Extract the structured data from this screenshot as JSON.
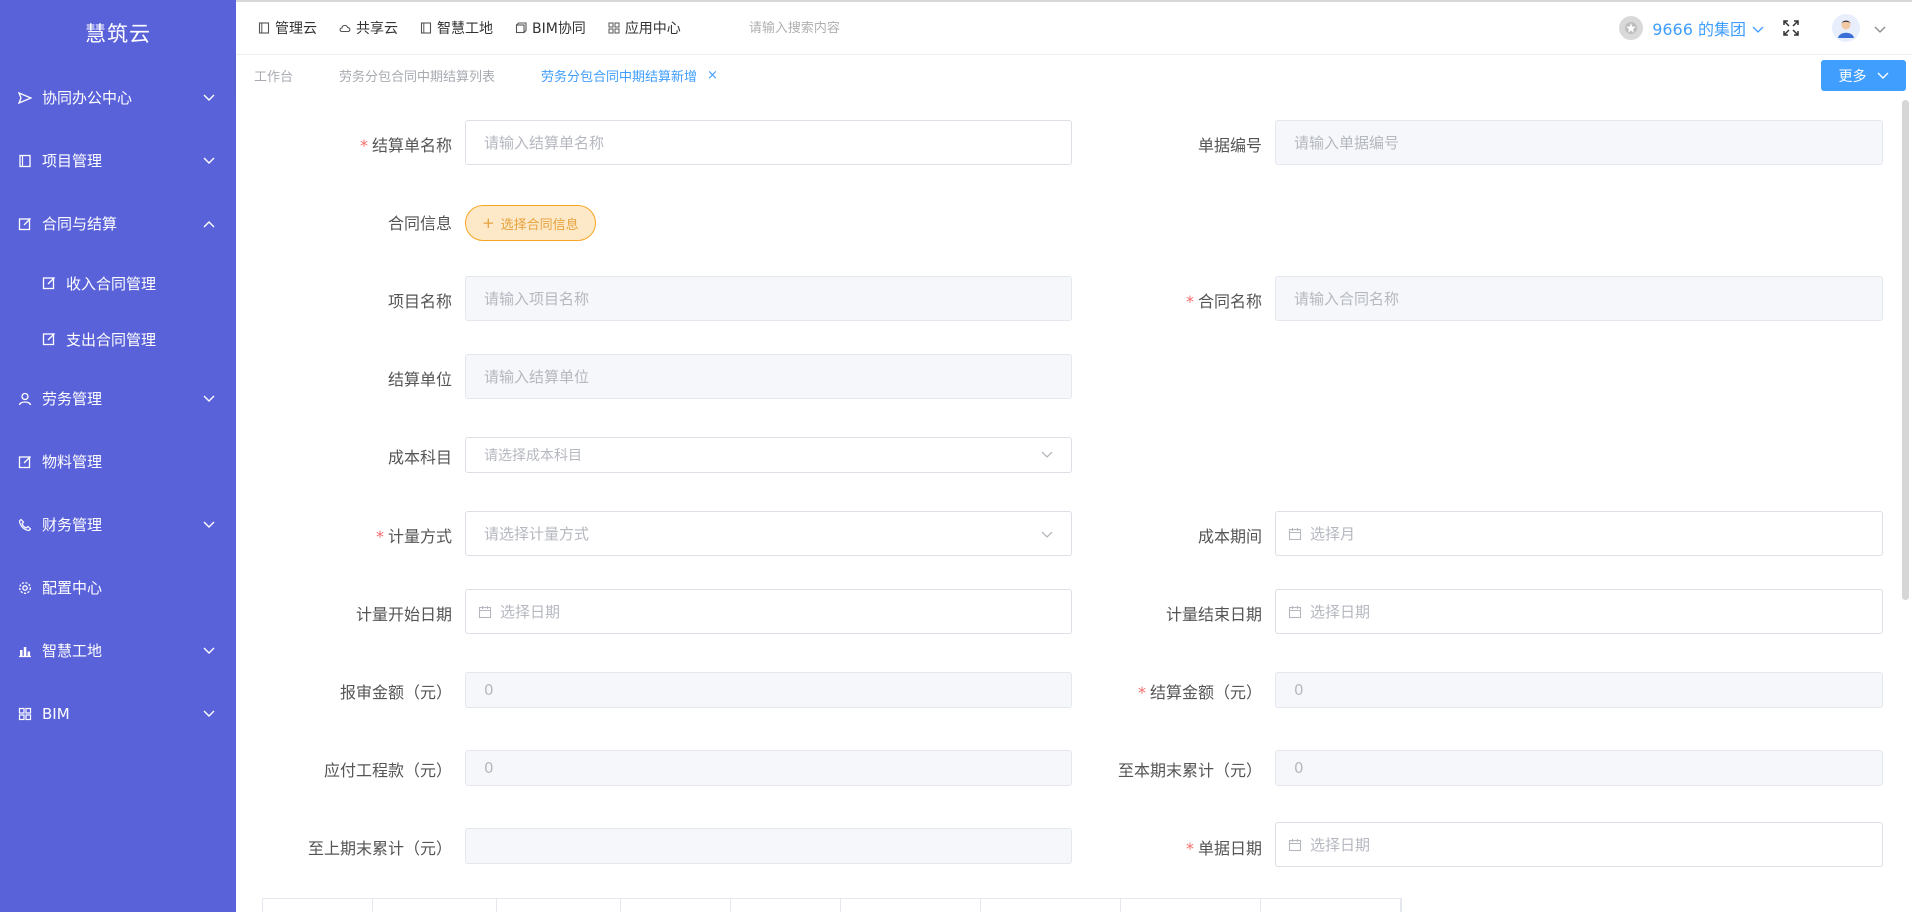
{
  "sidebar": {
    "logo": "慧筑云",
    "items": [
      {
        "label": "协同办公中心",
        "icon": "send-icon",
        "expandable": true
      },
      {
        "label": "项目管理",
        "icon": "book-icon",
        "expandable": true
      },
      {
        "label": "合同与结算",
        "icon": "edit-icon",
        "expandable": true,
        "expanded": true
      },
      {
        "label": "收入合同管理",
        "icon": "edit-icon",
        "sub": true
      },
      {
        "label": "支出合同管理",
        "icon": "edit-icon",
        "sub": true
      },
      {
        "label": "劳务管理",
        "icon": "user-icon",
        "expandable": true
      },
      {
        "label": "物料管理",
        "icon": "edit-icon",
        "expandable": false
      },
      {
        "label": "财务管理",
        "icon": "phone-icon",
        "expandable": true
      },
      {
        "label": "配置中心",
        "icon": "gear-icon",
        "expandable": false
      },
      {
        "label": "智慧工地",
        "icon": "bar-chart-icon",
        "expandable": true
      },
      {
        "label": "BIM",
        "icon": "grid-icon",
        "expandable": true
      }
    ]
  },
  "topbar": {
    "nav": [
      {
        "label": "管理云",
        "icon": "book-icon"
      },
      {
        "label": "共享云",
        "icon": "cloud-icon"
      },
      {
        "label": "智慧工地",
        "icon": "book-icon"
      },
      {
        "label": "BIM协同",
        "icon": "cube-icon"
      },
      {
        "label": "应用中心",
        "icon": "grid-icon"
      }
    ],
    "search_placeholder": "请输入搜索内容",
    "org_name": "9666 的集团"
  },
  "tabs": {
    "items": [
      {
        "label": "工作台",
        "active": false
      },
      {
        "label": "劳务分包合同中期结算列表",
        "active": false
      },
      {
        "label": "劳务分包合同中期结算新增",
        "active": true
      }
    ],
    "close_symbol": "×",
    "more_label": "更多"
  },
  "form": {
    "settlement_name": {
      "label": "结算单名称",
      "required": true,
      "placeholder": "请输入结算单名称"
    },
    "doc_number": {
      "label": "单据编号",
      "required": false,
      "placeholder": "请输入单据编号"
    },
    "contract_info": {
      "label": "合同信息",
      "button": "选择合同信息",
      "button_plus": "+"
    },
    "project_name": {
      "label": "项目名称",
      "required": false,
      "placeholder": "请输入项目名称"
    },
    "contract_name": {
      "label": "合同名称",
      "required": true,
      "placeholder": "请输入合同名称"
    },
    "settlement_unit": {
      "label": "结算单位",
      "required": false,
      "placeholder": "请输入结算单位"
    },
    "cost_subject": {
      "label": "成本科目",
      "required": false,
      "placeholder": "请选择成本科目"
    },
    "measure_method": {
      "label": "计量方式",
      "required": true,
      "placeholder": "请选择计量方式"
    },
    "cost_period": {
      "label": "成本期间",
      "required": false,
      "placeholder": "选择月"
    },
    "measure_start": {
      "label": "计量开始日期",
      "required": false,
      "placeholder": "选择日期"
    },
    "measure_end": {
      "label": "计量结束日期",
      "required": false,
      "placeholder": "选择日期"
    },
    "review_amount": {
      "label": "报审金额（元）",
      "required": false,
      "value": "0"
    },
    "settle_amount": {
      "label": "结算金额（元）",
      "required": true,
      "value": "0"
    },
    "payable": {
      "label": "应付工程款（元）",
      "required": false,
      "value": "0"
    },
    "cum_to_date": {
      "label": "至本期末累计（元）",
      "required": false,
      "value": "0"
    },
    "cum_prev": {
      "label": "至上期末累计（元）",
      "required": false,
      "value": ""
    },
    "doc_date": {
      "label": "单据日期",
      "required": true,
      "placeholder": "选择日期"
    },
    "required_mark": "*"
  },
  "colors": {
    "sidebar_bg": "#5a62d9",
    "accent": "#409eff",
    "required": "#f56c6c",
    "warn_btn_bg": "#fde9c8",
    "warn_btn_text": "#e6a23c"
  }
}
